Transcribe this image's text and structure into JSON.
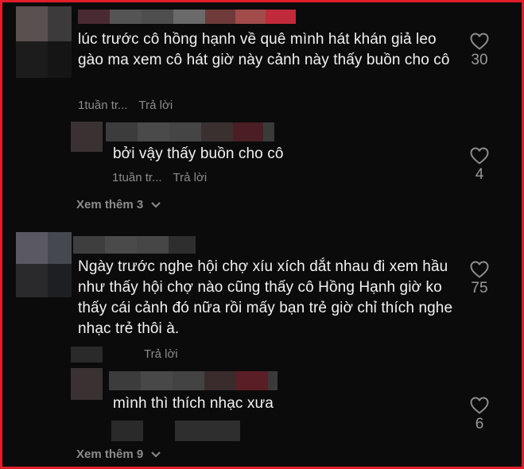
{
  "comments": [
    {
      "text": "lúc trước cô hồng hạnh về quê mình hát khán giả leo gào ma xem cô hát giờ này cảnh này thấy buồn cho cô",
      "time": "1tuần tr...",
      "reply_label": "Trả lời",
      "likes": "30"
    },
    {
      "text": "bởi vậy thấy buồn cho cô",
      "time": "1tuần tr...",
      "reply_label": "Trả lời",
      "likes": "4"
    },
    {
      "text": "Ngày trước nghe hội chợ xíu xích dắt nhau đi xem hầu như thấy hội chợ nào cũng thấy cô Hồng Hạnh giờ ko thấy cái cảnh đó nữa rồi mấy bạn trẻ giờ chỉ thích nghe nhạc trẻ thôi à.",
      "reply_label": "Trả lời",
      "likes": "75"
    },
    {
      "text": "mình thì thích nhạc xưa",
      "likes": "6"
    }
  ],
  "view_more_1": "Xem thêm 3",
  "view_more_2": "Xem thêm 9",
  "icons": {
    "like": "heart-outline-icon",
    "expand": "chevron-down-icon"
  },
  "colors": {
    "frame_border": "#e11d2a",
    "background": "#0b0b0b",
    "text": "#f2f2f2",
    "muted": "#8c8c8c"
  }
}
